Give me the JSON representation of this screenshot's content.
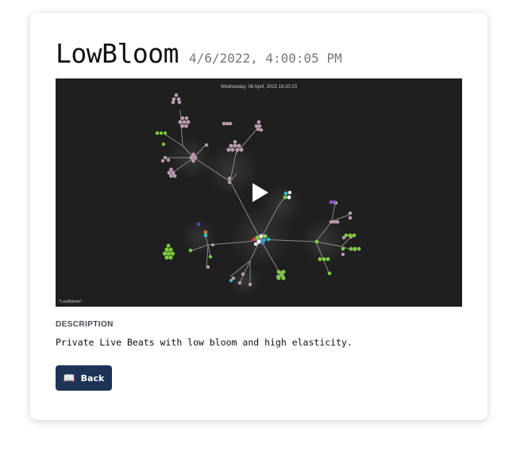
{
  "page": {
    "title": "LowBloom",
    "timestamp": "4/6/2022, 4:00:05 PM"
  },
  "video": {
    "overlay_date": "Wednesday, 06 April, 2022 16:20:23",
    "watermark": "\"LowBloom\"",
    "play_icon": "play-icon"
  },
  "description": {
    "label": "DESCRIPTION",
    "text": "Private Live Beats with low bloom and high elasticity."
  },
  "actions": {
    "back_label": "Back",
    "back_icon": "book-icon"
  },
  "colors": {
    "accent": "#1e3358",
    "video_bg": "#1f1f1f",
    "node_pink": "#b99cb0",
    "node_green": "#7ccb3c",
    "node_purple": "#8e5ad0"
  }
}
